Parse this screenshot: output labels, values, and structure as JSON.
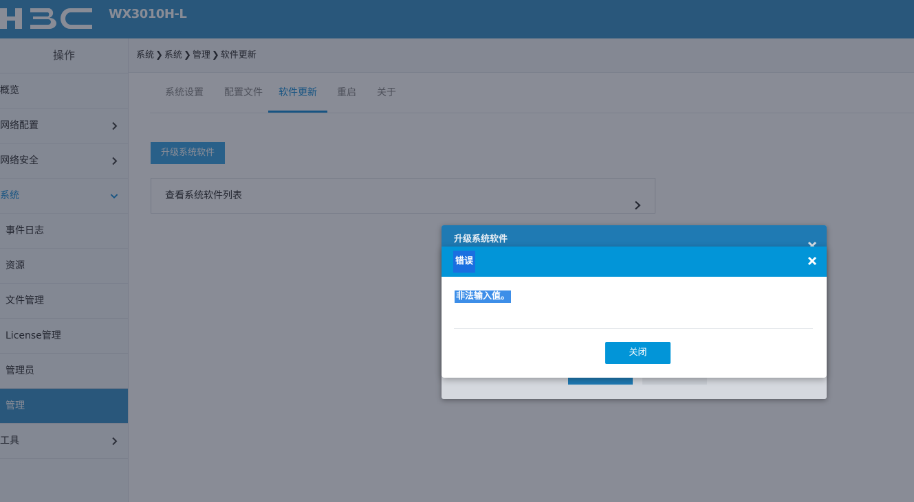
{
  "header": {
    "logo_text": "H3C",
    "model": "WX3010H-L"
  },
  "sidebar": {
    "title": "操作",
    "items": [
      {
        "label": "概览"
      },
      {
        "label": "网络配置"
      },
      {
        "label": "网络安全"
      },
      {
        "label": "系统"
      },
      {
        "label": "事件日志"
      },
      {
        "label": "资源"
      },
      {
        "label": "文件管理"
      },
      {
        "label": "License管理"
      },
      {
        "label": "管理员"
      },
      {
        "label": "管理"
      },
      {
        "label": "工具"
      }
    ]
  },
  "breadcrumb": [
    "系统",
    "系统",
    "管理",
    "软件更新"
  ],
  "tabs": [
    "系统设置",
    "配置文件",
    "软件更新",
    "重启",
    "关于"
  ],
  "main": {
    "upgrade_button": "升级系统软件",
    "software_list_row": "查看系统软件列表"
  },
  "back_dialog": {
    "title": "升级系统软件"
  },
  "error_dialog": {
    "title": "错误",
    "message": "非法输入值。",
    "close_button": "关闭"
  },
  "colors": {
    "brand": "#3f95c8",
    "accent": "#0295d8"
  }
}
